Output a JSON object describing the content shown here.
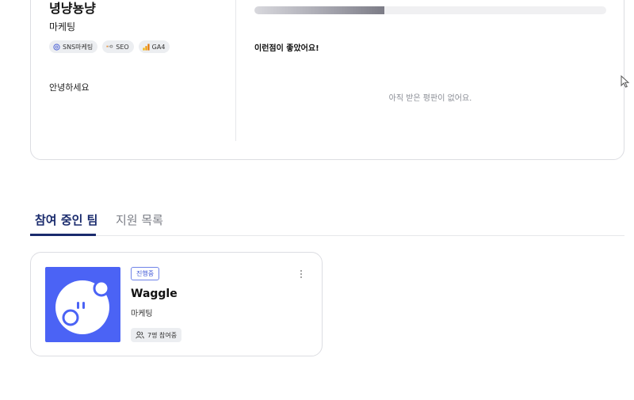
{
  "profile": {
    "name": "녕냥뇽냥",
    "role": "마케팅",
    "tags": [
      {
        "label": "SNS마케팅",
        "icon": "instagram-icon"
      },
      {
        "label": "SEO",
        "icon": "seo-icon"
      },
      {
        "label": "GA4",
        "icon": "analytics-icon"
      }
    ],
    "greeting": "안녕하세요",
    "progress": 0.37,
    "review_title": "이런점이 좋았어요!",
    "review_empty": "아직 받은 평판이 없어요."
  },
  "tabs": [
    {
      "label": "참여 중인 팀",
      "active": true
    },
    {
      "label": "지원 목록",
      "active": false
    }
  ],
  "team": {
    "status": "진행중",
    "name": "Waggle",
    "category": "마케팅",
    "members": "7명 참여중",
    "logo_color": "#4b63f5"
  },
  "colors": {
    "accent": "#1a2b6d",
    "badge": "#3e56d6"
  }
}
